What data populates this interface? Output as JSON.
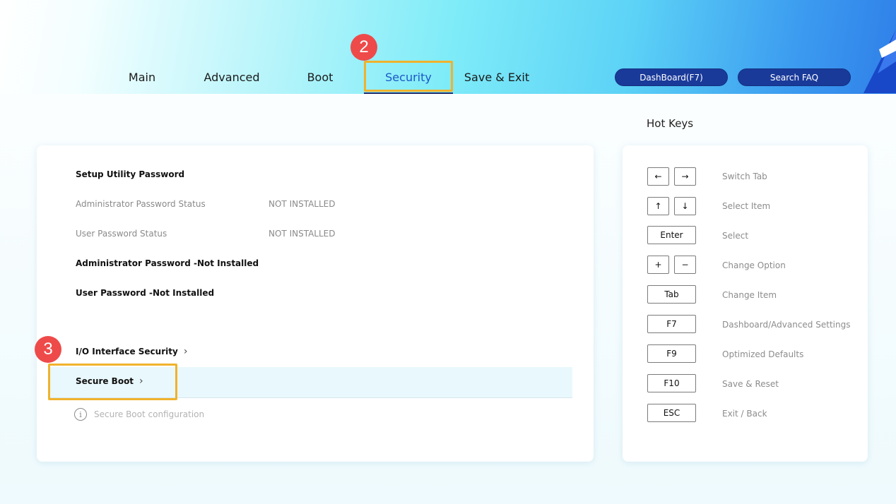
{
  "tabs": [
    {
      "label": "Main"
    },
    {
      "label": "Advanced"
    },
    {
      "label": "Boot"
    },
    {
      "label": "Security"
    },
    {
      "label": "Save & Exit"
    }
  ],
  "header_buttons": {
    "dashboard": "DashBoard(F7)",
    "search_faq": "Search FAQ"
  },
  "steps": {
    "security_step": "2",
    "secure_boot_step": "3"
  },
  "security": {
    "section_title": "Setup Utility Password",
    "admin_status_label": "Administrator Password Status",
    "admin_status_value": "NOT INSTALLED",
    "user_status_label": "User Password Status",
    "user_status_value": "NOT INSTALLED",
    "admin_password": "Administrator Password -Not Installed",
    "user_password": "User Password -Not Installed",
    "io_interface": "I/O Interface Security",
    "secure_boot": "Secure Boot",
    "help_text": "Secure Boot configuration"
  },
  "hotkeys": {
    "title": "Hot Keys",
    "items": [
      {
        "keys": [
          "←",
          "→"
        ],
        "desc": "Switch Tab"
      },
      {
        "keys": [
          "↑",
          "↓"
        ],
        "desc": "Select Item"
      },
      {
        "keys": [
          "Enter"
        ],
        "desc": "Select"
      },
      {
        "keys": [
          "+",
          "−"
        ],
        "desc": "Change Option"
      },
      {
        "keys": [
          "Tab"
        ],
        "desc": "Change Item"
      },
      {
        "keys": [
          "F7"
        ],
        "desc": "Dashboard/Advanced Settings"
      },
      {
        "keys": [
          "F9"
        ],
        "desc": "Optimized Defaults"
      },
      {
        "keys": [
          "F10"
        ],
        "desc": "Save & Reset"
      },
      {
        "keys": [
          "ESC"
        ],
        "desc": "Exit / Back"
      }
    ]
  },
  "colors": {
    "accent": "#1b57c8",
    "highlight": "#f0b22c",
    "badge": "#ee4a4a",
    "button": "#1a3a9a"
  }
}
